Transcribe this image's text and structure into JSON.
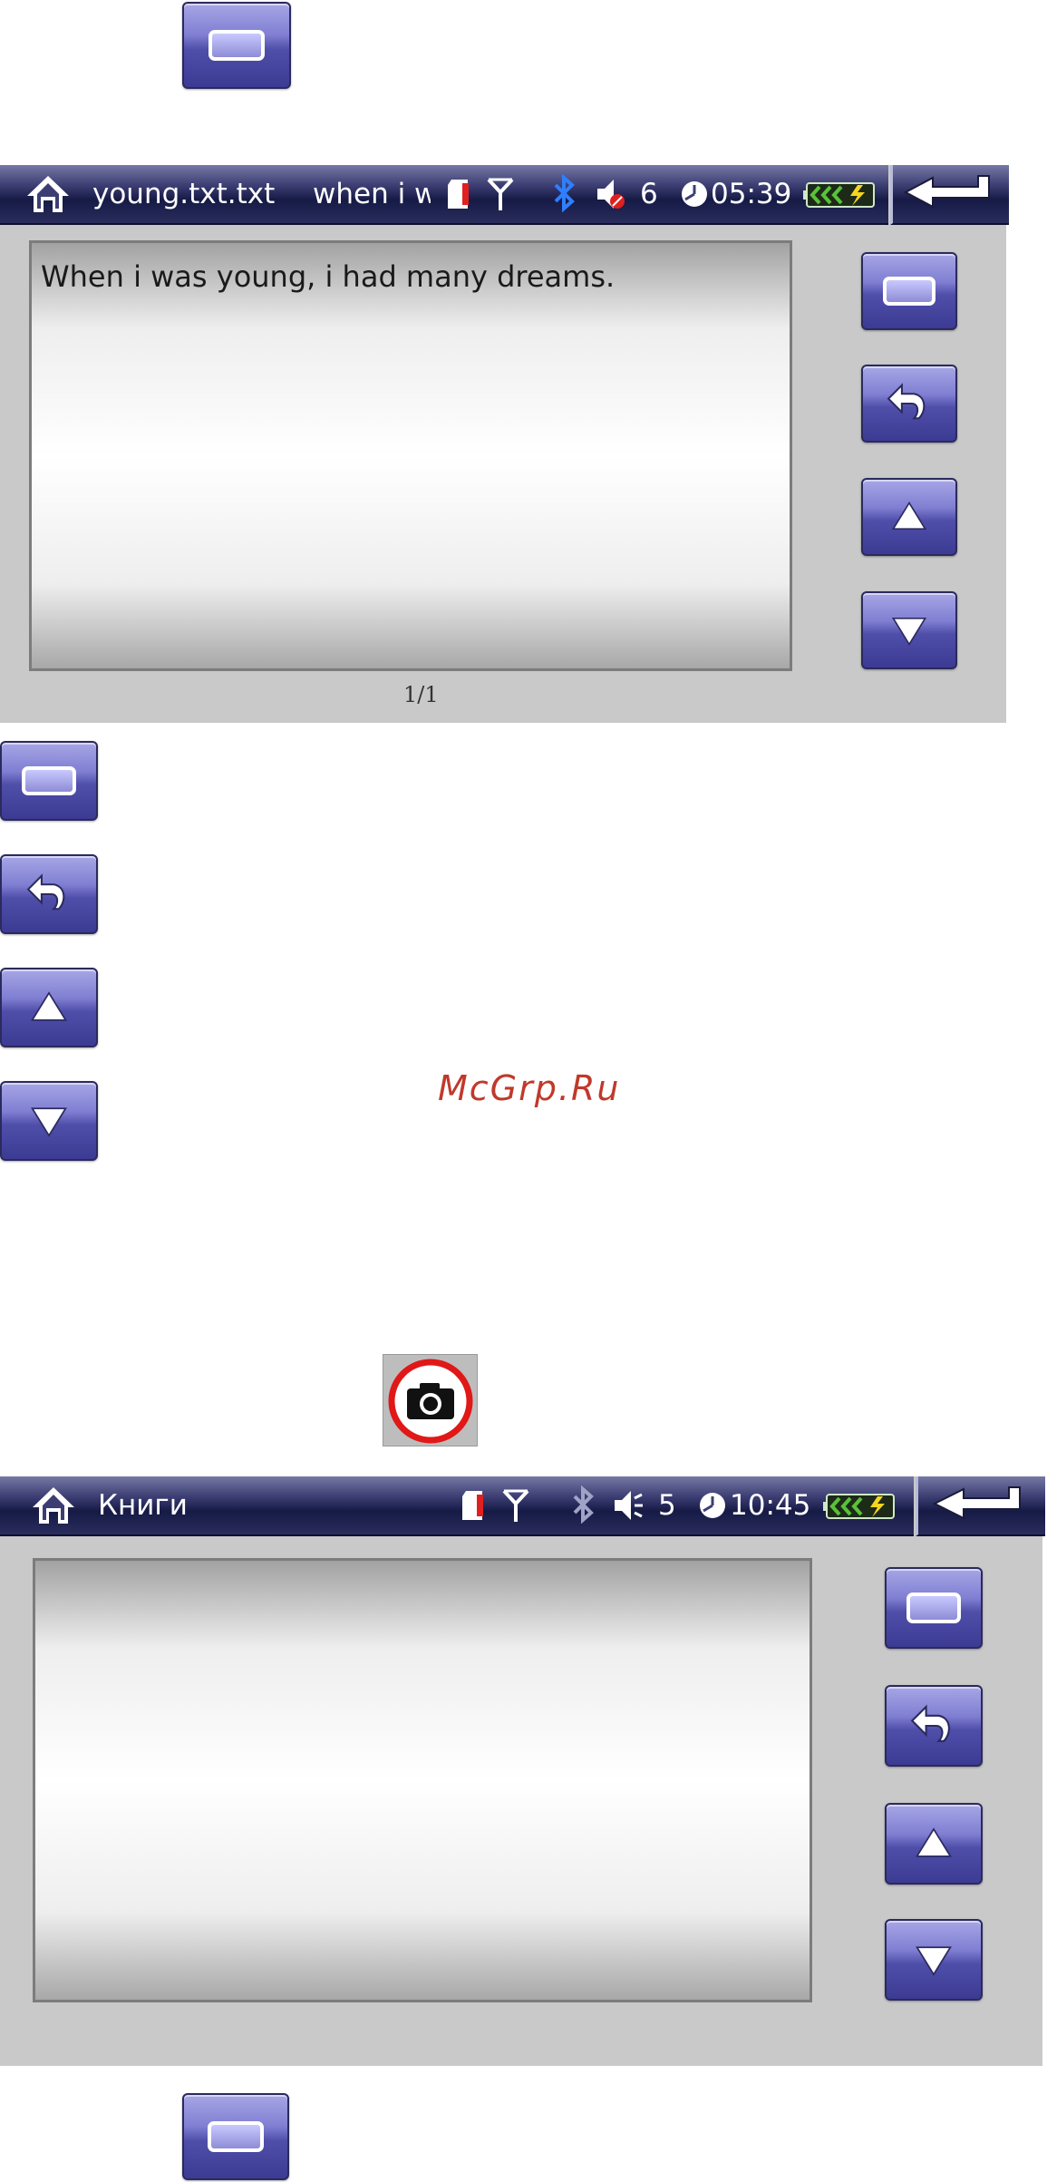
{
  "screen1": {
    "title": "young.txt.txt",
    "subtitle": "when i w",
    "volume": "6",
    "time": "05:39",
    "content_text": "When i was young, i had many dreams.",
    "page_indicator": "1/1"
  },
  "screen2": {
    "title": "Книги",
    "volume": "5",
    "time": "10:45"
  },
  "watermark": "McGrp.Ru",
  "icons": {
    "home": "home-icon",
    "sd_card": "sd-card-icon",
    "antenna": "antenna-icon",
    "bluetooth": "bluetooth-icon",
    "volume": "volume-icon",
    "clock": "clock-icon",
    "battery": "battery-icon",
    "back": "back-arrow-icon",
    "camera": "camera-icon"
  },
  "colors": {
    "button_purple": "#5a59b4",
    "statusbar_dark": "#161a45",
    "bluetooth_blue": "#2f7fff",
    "watermark_red": "#c0392b",
    "battery_green": "#59c13a"
  }
}
